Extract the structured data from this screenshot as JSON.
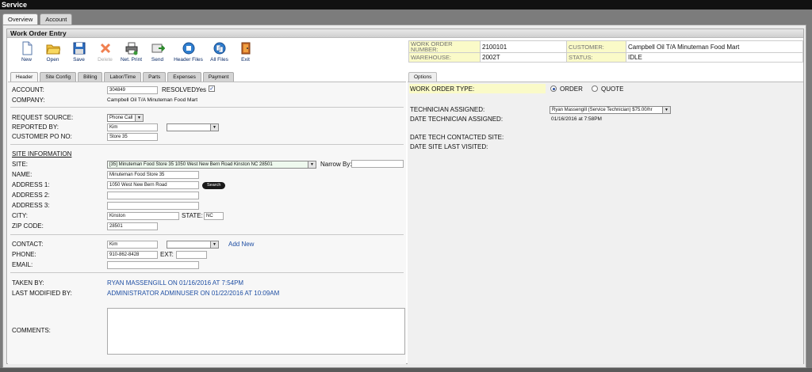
{
  "window": {
    "title": "Service"
  },
  "outer_tabs": [
    "Overview",
    "Account"
  ],
  "section": {
    "title": "Work Order Entry"
  },
  "toolbar": {
    "new": "New",
    "open": "Open",
    "save": "Save",
    "delete": "Delete",
    "net_print": "Net. Print",
    "send": "Send",
    "header_files": "Header Files",
    "all_files": "All Files",
    "exit": "Exit"
  },
  "info": {
    "wo_number_label": "WORK ORDER NUMBER:",
    "wo_number": "2100101",
    "customer_label": "CUSTOMER:",
    "customer": "Campbell Oil T/A Minuteman Food Mart",
    "warehouse_label": "WAREHOUSE:",
    "warehouse": "2002T",
    "status_label": "STATUS:",
    "status": "IDLE"
  },
  "inner_tabs": [
    "Header",
    "Site Config",
    "Billing",
    "Labor/Time",
    "Parts",
    "Expenses",
    "Payment"
  ],
  "options_tab": "Options",
  "header": {
    "account_label": "ACCOUNT:",
    "account": "304849",
    "resolved_label": "RESOLVED:",
    "resolved_value": "Yes",
    "resolved_check": "✓",
    "company_label": "COMPANY:",
    "company": "Campbell Oil T/A Minuteman Food Mart",
    "request_source_label": "REQUEST SOURCE:",
    "request_source": "Phone Call",
    "reported_by_label": "REPORTED BY:",
    "reported_by": "Kim",
    "customer_po_label": "CUSTOMER PO NO:",
    "customer_po": "Store 35",
    "site_info_heading": "SITE INFORMATION",
    "site_label": "SITE:",
    "site": "[35] Minuteman Food Store 35 1050 West New Bern Road Kinston NC 28501",
    "narrow_by_label": "Narrow By:",
    "name_label": "NAME:",
    "name": "Minuteman Food Store 35",
    "address1_label": "ADDRESS 1:",
    "address1": "1050 West New Bern Road",
    "search_label": "Search",
    "address2_label": "ADDRESS 2:",
    "address3_label": "ADDRESS 3:",
    "city_label": "CITY:",
    "city": "Kinston",
    "state_label": "STATE:",
    "state": "NC",
    "zip_label": "ZIP CODE:",
    "zip": "28501",
    "contact_label": "CONTACT:",
    "contact": "Kim",
    "add_new": "Add New",
    "phone_label": "PHONE:",
    "phone": "910-862-8428",
    "ext_label": "EXT:",
    "email_label": "EMAIL:",
    "taken_by_label": "TAKEN BY:",
    "taken_by": "RYAN MASSENGILL ON 01/16/2016 AT 7:54PM",
    "last_modified_label": "LAST MODIFIED BY:",
    "last_modified": "ADMINISTRATOR ADMINUSER ON 01/22/2016 AT 10:09AM",
    "comments_label": "COMMENTS:"
  },
  "options": {
    "wo_type_label": "WORK ORDER TYPE:",
    "order": "ORDER",
    "quote": "QUOTE",
    "tech_label": "TECHNICIAN ASSIGNED:",
    "tech": "Ryan Massengill (Service Technician) $75.00/hr",
    "date_tech_label": "DATE TECHNICIAN ASSIGNED:",
    "date_tech": "01/16/2016 at 7:58PM",
    "date_contacted_label": "DATE TECH CONTACTED SITE:",
    "date_visited_label": "DATE SITE LAST VISITED:"
  },
  "colors": {
    "label_bg": "#fafac8",
    "link": "#1f4fa3",
    "titlebar": "#111111"
  }
}
